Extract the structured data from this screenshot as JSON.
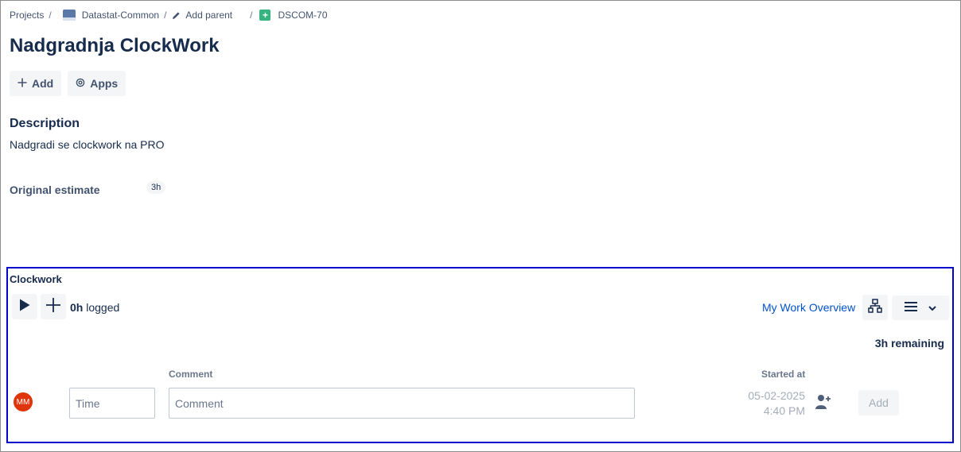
{
  "breadcrumb": {
    "projects": "Projects",
    "project": "Datastat-Common",
    "add_parent": "Add parent",
    "issue_key": "DSCOM-70",
    "separator": "/"
  },
  "issue": {
    "title": "Nadgradnja ClockWork"
  },
  "actions": {
    "add_label": "Add",
    "apps_label": "Apps"
  },
  "description": {
    "heading": "Description",
    "text": "Nadgradi se clockwork na PRO"
  },
  "estimate": {
    "label": "Original estimate",
    "value": "3h"
  },
  "clockwork": {
    "title": "Clockwork",
    "logged_value": "0h",
    "logged_suffix": " logged",
    "my_work_overview": "My Work Overview",
    "remaining": "3h remaining",
    "comment_label": "Comment",
    "started_label": "Started at",
    "avatar_initials": "MM",
    "time_placeholder": "Time",
    "comment_placeholder": "Comment",
    "started_date": "05-02-2025",
    "started_time": "4:40 PM",
    "add_button": "Add"
  },
  "colors": {
    "accent": "#0052cc",
    "panel_border": "#0000cc",
    "avatar": "#de350b",
    "story": "#36b37e"
  }
}
